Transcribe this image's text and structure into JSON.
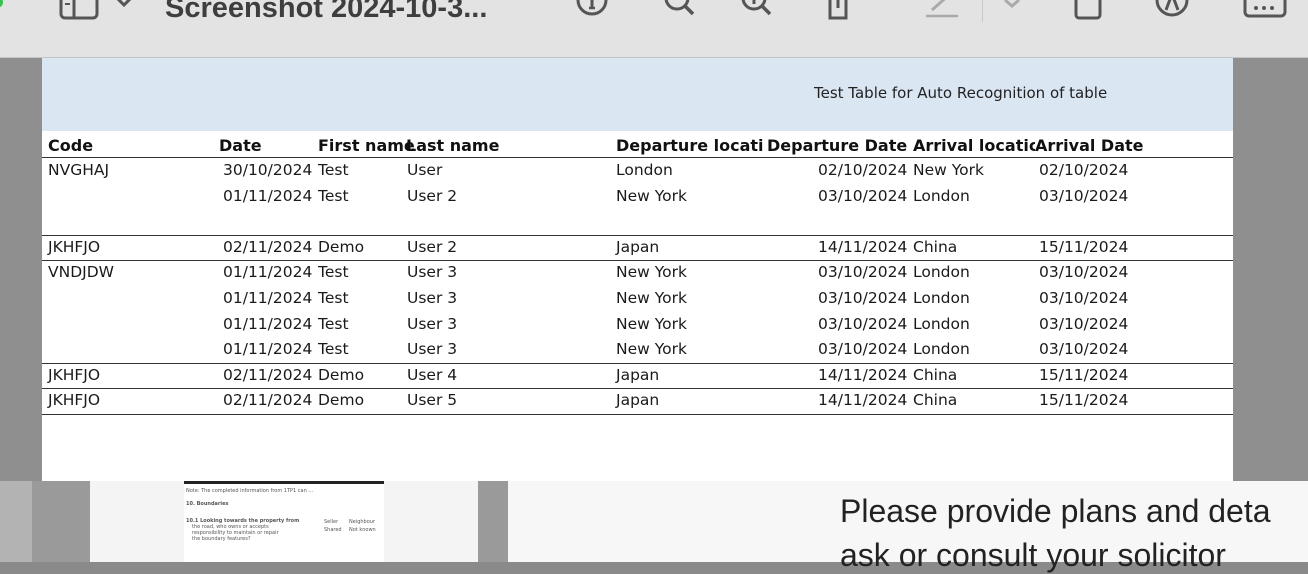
{
  "window": {
    "title": "Screenshot 2024-10-3..."
  },
  "toolbar": {
    "icons": [
      "sidebar-icon",
      "chevron-down-icon",
      "info-icon",
      "zoom-out-icon",
      "zoom-in-icon",
      "share-icon",
      "highlight-icon",
      "chevron-down-icon",
      "rotate-icon",
      "markup-icon",
      "more-icon"
    ]
  },
  "document": {
    "banner_title": "Test Table for Auto Recognition of table",
    "headers": [
      "Code",
      "Date",
      "First name",
      "Last name",
      "Departure locatic",
      "Departure Date",
      "Arrival locatic",
      "Arrival Date"
    ],
    "rows": [
      {
        "code": "NVGHAJ",
        "date": "30/10/2024",
        "first": "Test",
        "last": "User",
        "dep_loc": "London",
        "dep_date": "02/10/2024",
        "arr_loc": "New York",
        "arr_date": "02/10/2024"
      },
      {
        "code": "",
        "date": "01/11/2024",
        "first": "Test",
        "last": "User 2",
        "dep_loc": "New York",
        "dep_date": "03/10/2024",
        "arr_loc": "London",
        "arr_date": "03/10/2024"
      },
      {
        "code": "",
        "date": "",
        "first": "",
        "last": "",
        "dep_loc": "",
        "dep_date": "",
        "arr_loc": "",
        "arr_date": ""
      },
      {
        "code": "JKHFJO",
        "date": "02/11/2024",
        "first": "Demo",
        "last": "User 2",
        "dep_loc": "Japan",
        "dep_date": "14/11/2024",
        "arr_loc": "China",
        "arr_date": "15/11/2024"
      },
      {
        "code": "VNDJDW",
        "date": "01/11/2024",
        "first": "Test",
        "last": "User 3",
        "dep_loc": "New York",
        "dep_date": "03/10/2024",
        "arr_loc": "London",
        "arr_date": "03/10/2024"
      },
      {
        "code": "",
        "date": "01/11/2024",
        "first": "Test",
        "last": "User 3",
        "dep_loc": "New York",
        "dep_date": "03/10/2024",
        "arr_loc": "London",
        "arr_date": "03/10/2024"
      },
      {
        "code": "",
        "date": "01/11/2024",
        "first": "Test",
        "last": "User 3",
        "dep_loc": "New York",
        "dep_date": "03/10/2024",
        "arr_loc": "London",
        "arr_date": "03/10/2024"
      },
      {
        "code": "",
        "date": "01/11/2024",
        "first": "Test",
        "last": "User 3",
        "dep_loc": "New York",
        "dep_date": "03/10/2024",
        "arr_loc": "London",
        "arr_date": "03/10/2024"
      },
      {
        "code": "JKHFJO",
        "date": "02/11/2024",
        "first": "Demo",
        "last": "User 4",
        "dep_loc": "Japan",
        "dep_date": "14/11/2024",
        "arr_loc": "China",
        "arr_date": "15/11/2024"
      },
      {
        "code": "JKHFJO",
        "date": "02/11/2024",
        "first": "Demo",
        "last": "User 5",
        "dep_loc": "Japan",
        "dep_date": "14/11/2024",
        "arr_loc": "China",
        "arr_date": "15/11/2024"
      }
    ]
  },
  "thumbnail": {
    "lines": [
      "Note: The completed information from 1TP1 can ...",
      "10. Boundaries",
      "10.1 Looking towards the property from",
      "the road, who owns or accepts",
      "responsibility to maintain or repair",
      "the boundary features?"
    ],
    "option_labels": [
      "Seller",
      "Neighbour",
      "Shared",
      "Not known"
    ]
  },
  "next_page": {
    "line1": "Please provide plans and deta",
    "line2": "ask or consult your solicitor"
  },
  "colors": {
    "banner": "#dbe6f3",
    "toolbar": "#e3e3e3",
    "canvas": "#8f8f8f"
  }
}
